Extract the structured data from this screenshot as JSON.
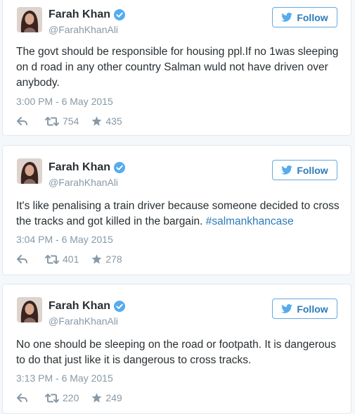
{
  "colors": {
    "link": "#2b7bb9",
    "secondary_text": "#8899a6",
    "verified": "#55acee",
    "border": "#e1e8ed"
  },
  "tweets": [
    {
      "author": {
        "name": "Farah Khan",
        "handle": "@FarahKhanAli",
        "verified": true
      },
      "follow_label": "Follow",
      "text": "The govt should be responsible for housing ppl.If no 1was sleeping on d road in any other country Salman wuld not have driven over anybody.",
      "hashtag": "",
      "timestamp": "3:00 PM - 6 May 2015",
      "retweets": "754",
      "favorites": "435"
    },
    {
      "author": {
        "name": "Farah Khan",
        "handle": "@FarahKhanAli",
        "verified": true
      },
      "follow_label": "Follow",
      "text": "It's like penalising a train driver because someone decided to cross the tracks and got killed in the bargain.",
      "hashtag": "#salmankhancase",
      "timestamp": "3:04 PM - 6 May 2015",
      "retweets": "401",
      "favorites": "278"
    },
    {
      "author": {
        "name": "Farah Khan",
        "handle": "@FarahKhanAli",
        "verified": true
      },
      "follow_label": "Follow",
      "text": "No one should be sleeping on the road or footpath. It is dangerous to do that just like it is dangerous to cross tracks.",
      "hashtag": "",
      "timestamp": "3:13 PM - 6 May 2015",
      "retweets": "220",
      "favorites": "249"
    }
  ]
}
